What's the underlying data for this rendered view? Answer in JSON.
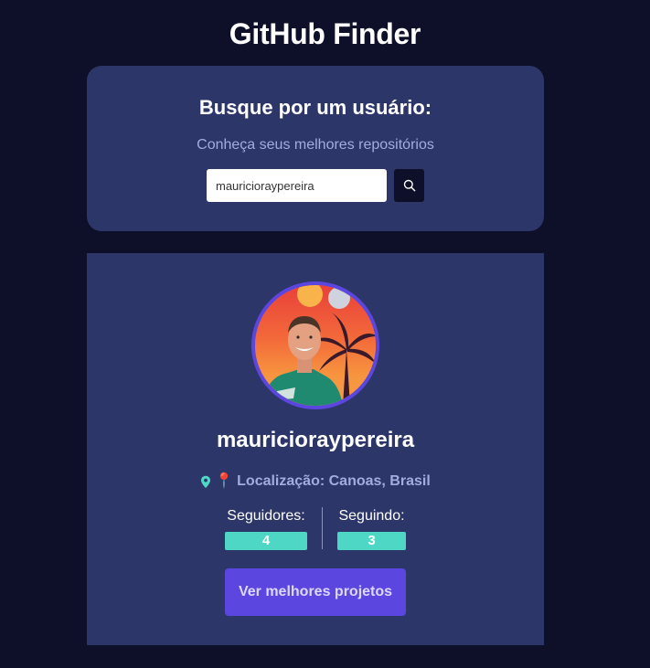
{
  "app": {
    "title": "GitHub Finder"
  },
  "search": {
    "heading": "Busque por um usuário:",
    "subtitle": "Conheça seus melhores repositórios",
    "input_value": "mauricioraypereira",
    "button_icon": "search-icon"
  },
  "profile": {
    "avatar_icon": "avatar",
    "username": "mauricioraypereira",
    "location_icon": "map-pin-icon",
    "location_emoji": "📍",
    "location_text": "Localização: Canoas, Brasil",
    "followers_label": "Seguidores:",
    "followers_count": "4",
    "following_label": "Seguindo:",
    "following_count": "3",
    "projects_button_label": "Ver melhores projetos"
  },
  "colors": {
    "background": "#0e0f29",
    "card": "#2d3668",
    "accent": "#5b47e0",
    "teal": "#4fd7c6",
    "muted_text": "#a3acdf"
  }
}
